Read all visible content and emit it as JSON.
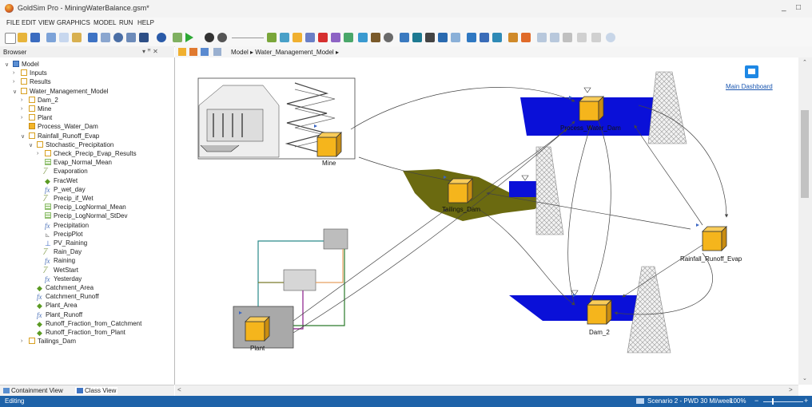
{
  "window": {
    "title": "GoldSim Pro - MiningWaterBalance.gsm*",
    "min": "_",
    "max": "□"
  },
  "menu": [
    "FILE",
    "EDIT",
    "VIEW",
    "GRAPHICS",
    "MODEL",
    "RUN",
    "HELP"
  ],
  "browser": {
    "title": "Browser",
    "pins": "▾ ꟸ ✕",
    "tree": [
      {
        "label": "Model",
        "icon": "model-icon"
      },
      {
        "label": "Inputs",
        "icon": "folder-icon"
      },
      {
        "label": "Results",
        "icon": "folder-icon"
      },
      {
        "label": "Water_Management_Model",
        "icon": "folder-icon"
      },
      {
        "label": "Dam_2",
        "icon": "folder-icon"
      },
      {
        "label": "Mine",
        "icon": "folder-icon"
      },
      {
        "label": "Plant",
        "icon": "folder-icon"
      },
      {
        "label": "Process_Water_Dam",
        "icon": "folder-filled-icon"
      },
      {
        "label": "Rainfall_Runoff_Evap",
        "icon": "folder-icon"
      },
      {
        "label": "Stochastic_Precipitation",
        "icon": "folder-icon"
      },
      {
        "label": "Check_Precip_Evap_Results",
        "icon": "folder-icon"
      },
      {
        "label": "Evap_Normal_Mean",
        "icon": "table-icon"
      },
      {
        "label": "Evaporation",
        "icon": "timeseries-icon"
      },
      {
        "label": "FracWet",
        "icon": "data-icon"
      },
      {
        "label": "P_wet_day",
        "icon": "expression-icon"
      },
      {
        "label": "Precip_if_Wet",
        "icon": "timeseries-icon"
      },
      {
        "label": "Precip_LogNormal_Mean",
        "icon": "table-icon"
      },
      {
        "label": "Precip_LogNormal_StDev",
        "icon": "table-icon"
      },
      {
        "label": "Precipitation",
        "icon": "expression-icon"
      },
      {
        "label": "PrecipPlot",
        "icon": "plot-icon"
      },
      {
        "label": "PV_Raining",
        "icon": "previous-value-icon"
      },
      {
        "label": "Rain_Day",
        "icon": "timeseries-icon"
      },
      {
        "label": "Raining",
        "icon": "expression-icon"
      },
      {
        "label": "WetStart",
        "icon": "timeseries-icon"
      },
      {
        "label": "Yesterday",
        "icon": "expression-icon"
      },
      {
        "label": "Catchment_Area",
        "icon": "data-icon"
      },
      {
        "label": "Catchment_Runoff",
        "icon": "expression-icon"
      },
      {
        "label": "Plant_Area",
        "icon": "data-icon"
      },
      {
        "label": "Plant_Runoff",
        "icon": "expression-icon"
      },
      {
        "label": "Runoff_Fraction_from_Catchment",
        "icon": "data-icon"
      },
      {
        "label": "Runoff_Fraction_from_Plant",
        "icon": "data-icon"
      },
      {
        "label": "Tailings_Dam",
        "icon": "folder-icon"
      }
    ],
    "tabs": [
      "Containment View",
      "Class View"
    ]
  },
  "breadcrumb": [
    "Model",
    "Water_Management_Model"
  ],
  "canvas": {
    "elements": {
      "mine": "Mine",
      "process_water_dam": "Process_Water_Dam",
      "tailings_dam": "Tailings_Dam",
      "rainfall": "Rainfall_Runoff_Evap",
      "plant": "Plant",
      "dam2": "Dam_2"
    },
    "dashboard_link": "Main Dashboard"
  },
  "status": {
    "left": "Editing",
    "scenario": "Scenario 2 - PWD 30 Ml/week",
    "zoom": "100%",
    "zoom_minus": "−",
    "zoom_plus": "+"
  },
  "colors": {
    "accent": "#1e62a8",
    "element_fill": "#f5b51c",
    "water": "#0a10d8",
    "tailings": "#6b6a10"
  }
}
